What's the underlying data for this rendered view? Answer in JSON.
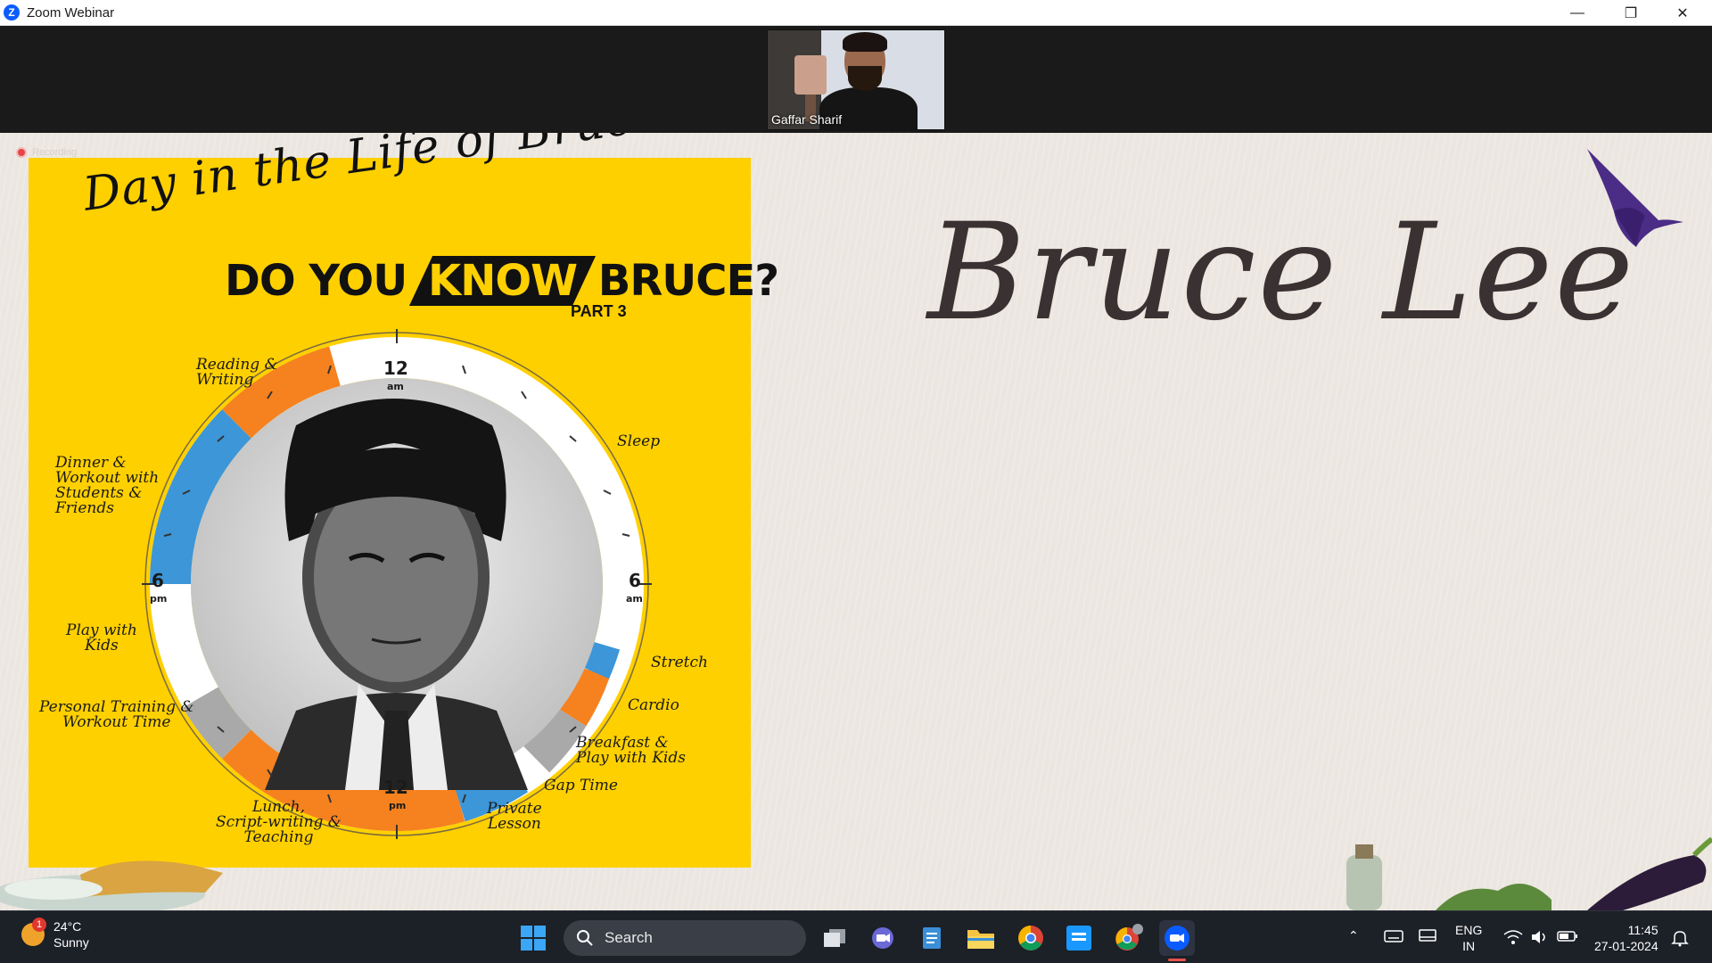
{
  "window": {
    "title": "Zoom Webinar",
    "minimize": "—",
    "restore": "❐",
    "close": "✕"
  },
  "participant": {
    "name": "Gaffar Sharif"
  },
  "recording": {
    "label": "Recording"
  },
  "slide": {
    "title": "Bruce Lee"
  },
  "poster": {
    "script_title": "Day in the Life of Bruce Lee",
    "headline_pre": "DO YOU",
    "headline_know": "KNOW",
    "headline_post": "BRUCE?",
    "part": "PART 3",
    "clock": {
      "top": "12",
      "top_sub": "am",
      "right": "6",
      "right_sub": "am",
      "bottom": "12",
      "bottom_sub": "pm",
      "left": "6",
      "left_sub": "pm"
    },
    "labels": {
      "reading": "Reading &\nWriting",
      "sleep": "Sleep",
      "dinner": "Dinner &\nWorkout with\nStudents &\nFriends",
      "play_kids": "Play with\nKids",
      "personal": "Personal Training &\nWorkout Time",
      "lunch": "Lunch,\nScript-writing &\nTeaching",
      "stretch": "Stretch",
      "cardio": "Cardio",
      "breakfast": "Breakfast &\nPlay with Kids",
      "gap": "Gap Time",
      "private": "Private\nLesson"
    },
    "colors": {
      "background": "#ffd000",
      "orange": "#f5821f",
      "blue": "#3c96d8",
      "gray": "#a9a9a9",
      "white": "#ffffff"
    }
  },
  "taskbar": {
    "weather_temp": "24°C",
    "weather_desc": "Sunny",
    "weather_badge": "1",
    "search_label": "Search",
    "lang_top": "ENG",
    "lang_bottom": "IN",
    "time": "11:45",
    "date": "27-01-2024"
  }
}
